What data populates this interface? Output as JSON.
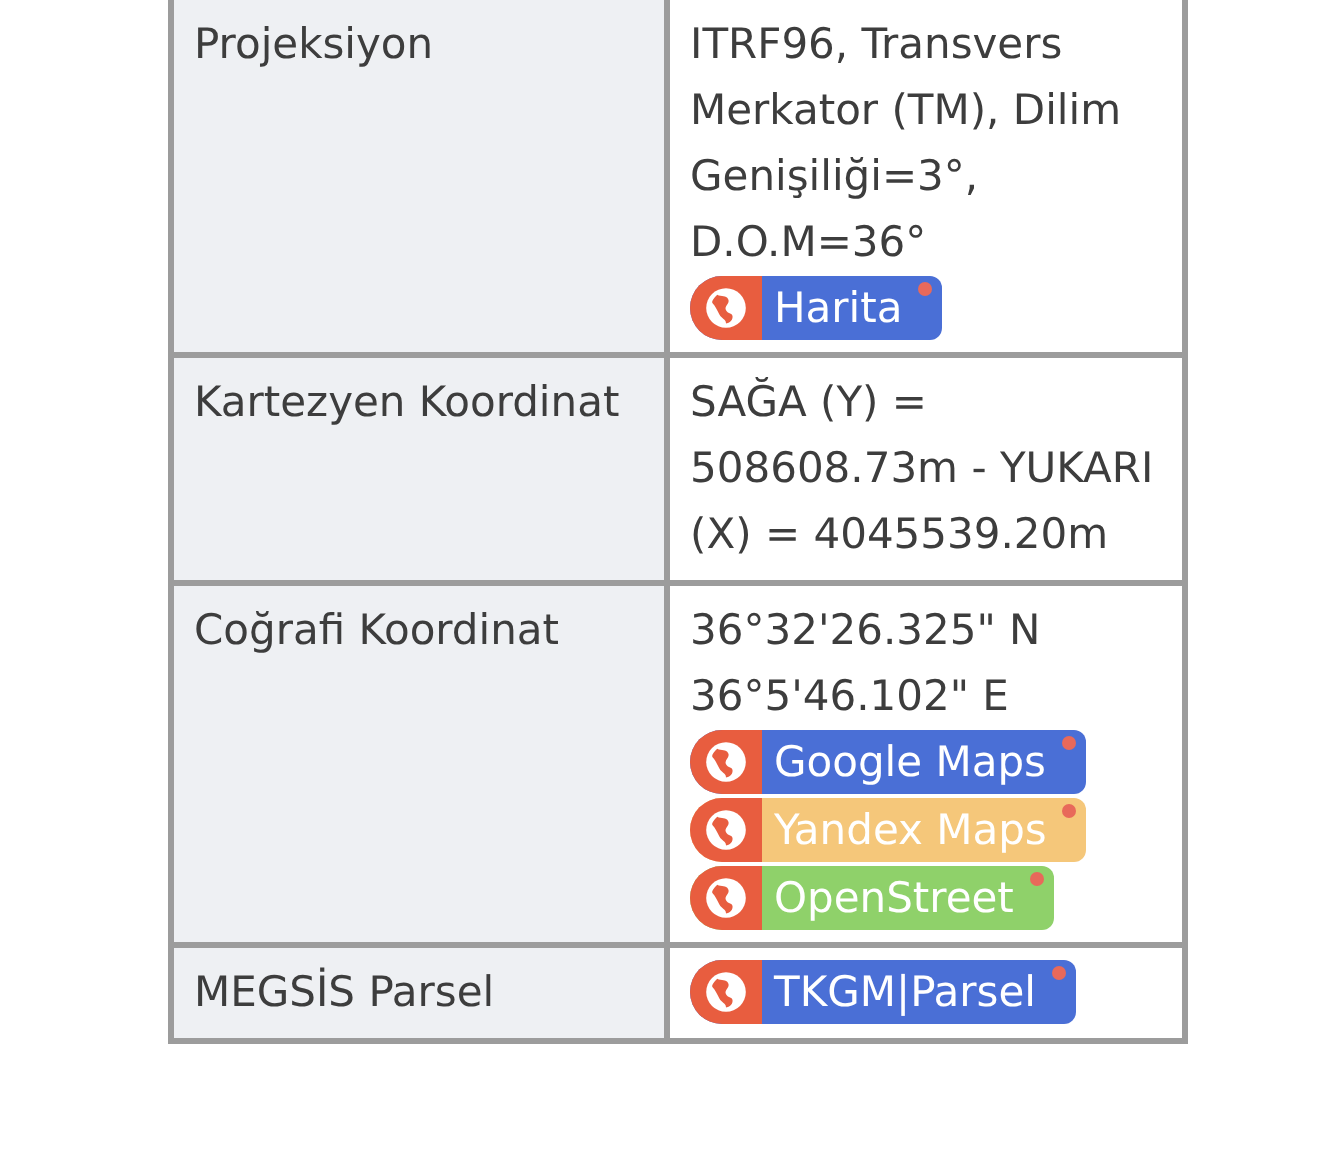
{
  "rows": [
    {
      "label": "Projeksiyon",
      "texts": [
        "ITRF96, Transvers Merkator (TM), Dilim Genişiliği=3°, D.O.M=36°"
      ],
      "links": [
        {
          "label": "Harita",
          "color": "#4a6fd6"
        }
      ]
    },
    {
      "label": "Kartezyen Koordinat",
      "texts": [
        "SAĞA (Y) = 508608.73m - YUKARI (X) = 4045539.20m"
      ],
      "links": []
    },
    {
      "label": "Coğrafi Koordinat",
      "texts": [
        "36°32'26.325\" N",
        "36°5'46.102\" E"
      ],
      "links": [
        {
          "label": "Google Maps",
          "color": "#4a6fd6"
        },
        {
          "label": "Yandex Maps",
          "color": "#f5c77a"
        },
        {
          "label": "OpenStreet",
          "color": "#8fd16a"
        }
      ]
    },
    {
      "label": "MEGSİS Parsel",
      "texts": [],
      "links": [
        {
          "label": "TKGM|Parsel",
          "color": "#4a6fd6"
        }
      ]
    }
  ]
}
